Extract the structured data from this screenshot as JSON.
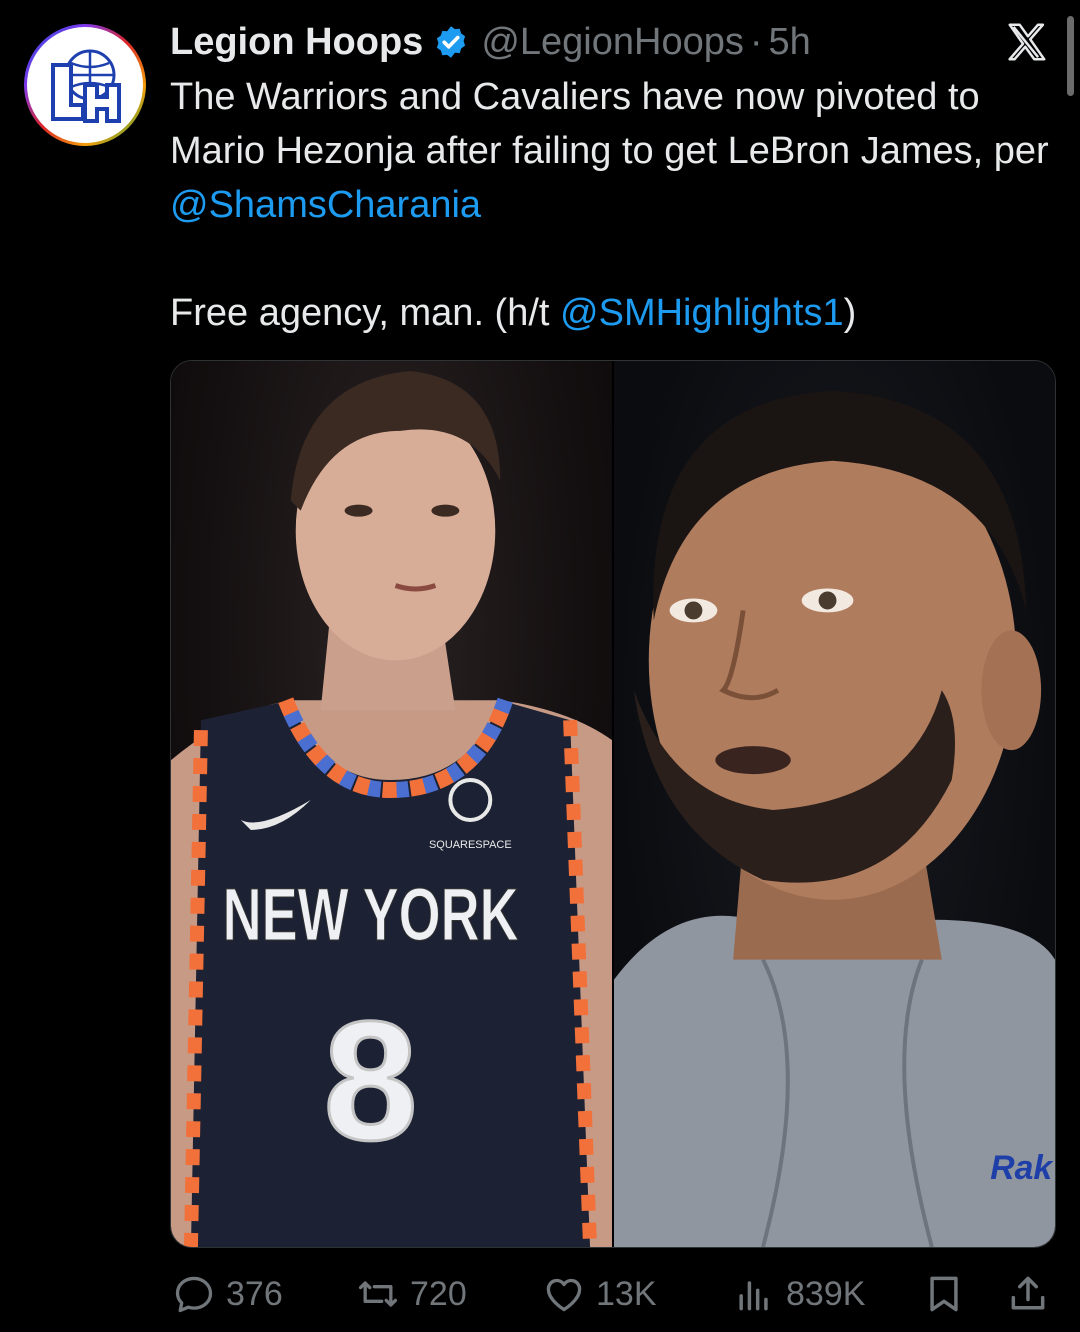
{
  "tweet": {
    "author_name": "Legion Hoops",
    "handle": "@LegionHoops",
    "separator": "·",
    "time": "5h",
    "text_line1_pre": "The Warriors and Cavaliers have now pivoted to Mario Hezonja after failing to get LeBron James, per ",
    "mention1": "@ShamsCharania",
    "text_line2_pre": "Free agency, man. (h/t ",
    "mention2": "@SMHighlights1",
    "text_line2_post": ")"
  },
  "avatar": {
    "icon": "legion-hoops-logo",
    "lettering": "LH"
  },
  "media": {
    "left_photo": {
      "jersey_text": "NEW YORK",
      "jersey_number": "8",
      "sponsor": "SQUARESPACE"
    },
    "right_photo": {
      "hoodie_text": "Rak"
    }
  },
  "actions": {
    "replies": "376",
    "retweets": "720",
    "likes": "13K",
    "views": "839K"
  },
  "colors": {
    "background": "#000000",
    "text": "#e7e9ea",
    "secondary": "#71767b",
    "link": "#1d9bf0",
    "verified": "#1d9bf0"
  }
}
